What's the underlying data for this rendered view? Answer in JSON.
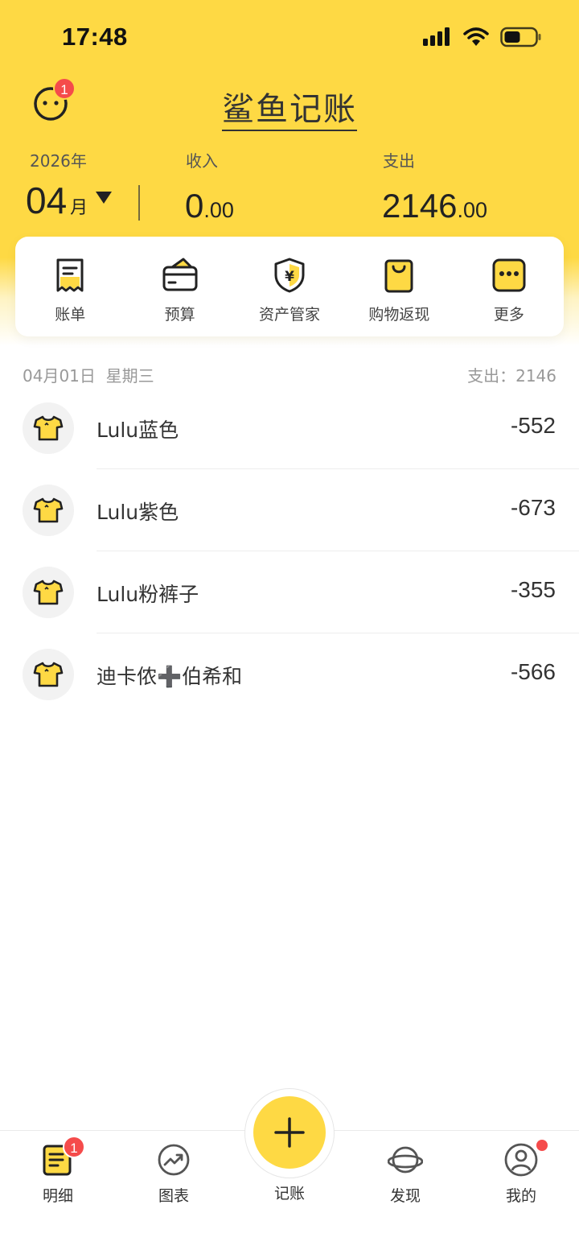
{
  "status_bar": {
    "time": "17:48"
  },
  "header": {
    "app_title": "鲨鱼记账",
    "notification_badge": "1",
    "accent_color": "#FED944"
  },
  "summary": {
    "year": "2026年",
    "month": "04",
    "month_unit": "月",
    "income_label": "收入",
    "income_int": "0",
    "income_dec": ".00",
    "expense_label": "支出",
    "expense_int": "2146",
    "expense_dec": ".00"
  },
  "quick_actions": [
    {
      "label": "账单",
      "icon": "bill-icon"
    },
    {
      "label": "预算",
      "icon": "budget-wallet-icon"
    },
    {
      "label": "资产管家",
      "icon": "asset-shield-icon"
    },
    {
      "label": "购物返现",
      "icon": "shopping-bag-icon"
    },
    {
      "label": "更多",
      "icon": "more-icon"
    }
  ],
  "day_group": {
    "date": "04月01日  星期三",
    "total": "支出：2146"
  },
  "records": [
    {
      "name": "Lulu蓝色",
      "amount": "-552",
      "icon": "tshirt-icon"
    },
    {
      "name": "Lulu紫色",
      "amount": "-673",
      "icon": "tshirt-icon"
    },
    {
      "name": "Lulu粉裤子",
      "amount": "-355",
      "icon": "tshirt-icon"
    },
    {
      "name": "迪卡侬➕伯希和",
      "amount": "-566",
      "icon": "tshirt-icon"
    }
  ],
  "tabbar": {
    "details_label": "明细",
    "details_badge": "1",
    "charts_label": "图表",
    "add_label": "记账",
    "discover_label": "发现",
    "mine_label": "我的"
  }
}
